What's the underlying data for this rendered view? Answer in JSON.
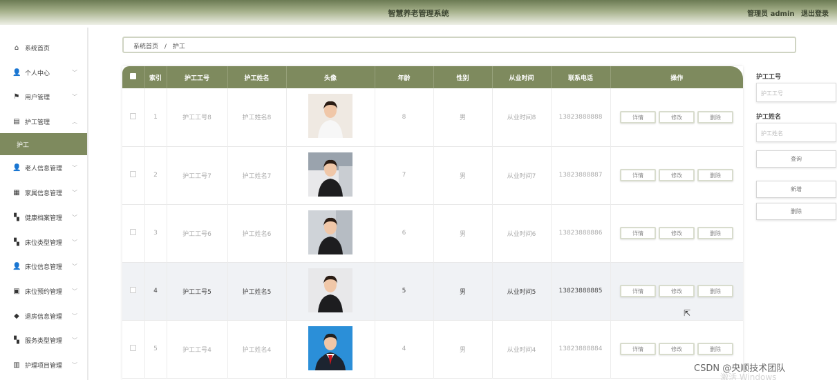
{
  "header": {
    "title": "智慧养老管理系统",
    "user_label": "管理员 admin",
    "logout_label": "退出登录"
  },
  "sidebar": {
    "items": [
      {
        "label": "系统首页",
        "icon": "home-icon",
        "glyph": "⌂",
        "expandable": false
      },
      {
        "label": "个人中心",
        "icon": "person-icon",
        "glyph": "👤",
        "expandable": true
      },
      {
        "label": "用户管理",
        "icon": "flag-icon",
        "glyph": "⚑",
        "expandable": true
      },
      {
        "label": "护工管理",
        "icon": "doc-icon",
        "glyph": "▤",
        "expandable": true,
        "expanded": true
      },
      {
        "label": "护工",
        "active": true
      },
      {
        "label": "老人信息管理",
        "icon": "person-icon",
        "glyph": "👤",
        "expandable": true
      },
      {
        "label": "家属信息管理",
        "icon": "building-icon",
        "glyph": "▦",
        "expandable": true
      },
      {
        "label": "健康档案管理",
        "icon": "grid-icon",
        "glyph": "▚",
        "expandable": true
      },
      {
        "label": "床位类型管理",
        "icon": "grid-icon",
        "glyph": "▚",
        "expandable": true
      },
      {
        "label": "床位信息管理",
        "icon": "person-icon",
        "glyph": "👤",
        "expandable": true
      },
      {
        "label": "床位预约管理",
        "icon": "edit-icon",
        "glyph": "▣",
        "expandable": true
      },
      {
        "label": "退房信息管理",
        "icon": "pin-icon",
        "glyph": "◆",
        "expandable": true
      },
      {
        "label": "服务类型管理",
        "icon": "grid-icon",
        "glyph": "▚",
        "expandable": true
      },
      {
        "label": "护理项目管理",
        "icon": "trash-icon",
        "glyph": "▥",
        "expandable": true
      }
    ]
  },
  "breadcrumb": {
    "home": "系统首页",
    "separator": "/",
    "current": "护工"
  },
  "table": {
    "headers": [
      "索引",
      "护工工号",
      "护工姓名",
      "头像",
      "年龄",
      "性别",
      "从业时间",
      "联系电话",
      "操作"
    ],
    "actions": [
      "详情",
      "修改",
      "删除"
    ],
    "rows": [
      {
        "index": "1",
        "id": "护工工号8",
        "name": "护工姓名8",
        "age": "8",
        "gender": "男",
        "since": "从业时间8",
        "phone": "13823888888"
      },
      {
        "index": "2",
        "id": "护工工号7",
        "name": "护工姓名7",
        "age": "7",
        "gender": "男",
        "since": "从业时间7",
        "phone": "13823888887"
      },
      {
        "index": "3",
        "id": "护工工号6",
        "name": "护工姓名6",
        "age": "6",
        "gender": "男",
        "since": "从业时间6",
        "phone": "13823888886"
      },
      {
        "index": "4",
        "id": "护工工号5",
        "name": "护工姓名5",
        "age": "5",
        "gender": "男",
        "since": "从业时间5",
        "phone": "13823888885"
      },
      {
        "index": "5",
        "id": "护工工号4",
        "name": "护工姓名4",
        "age": "4",
        "gender": "男",
        "since": "从业时间4",
        "phone": "13823888884"
      }
    ]
  },
  "search": {
    "id_label": "护工工号",
    "id_placeholder": "护工工号",
    "name_label": "护工姓名",
    "name_placeholder": "护工姓名",
    "query_label": "查询",
    "add_label": "新增",
    "delete_label": "删除"
  },
  "watermark": {
    "csdn": "CSDN @央顺技术团队",
    "windows": "激活 Windows"
  },
  "colors": {
    "primary": "#7e8a5e",
    "header_dark": "#6b7a53"
  }
}
